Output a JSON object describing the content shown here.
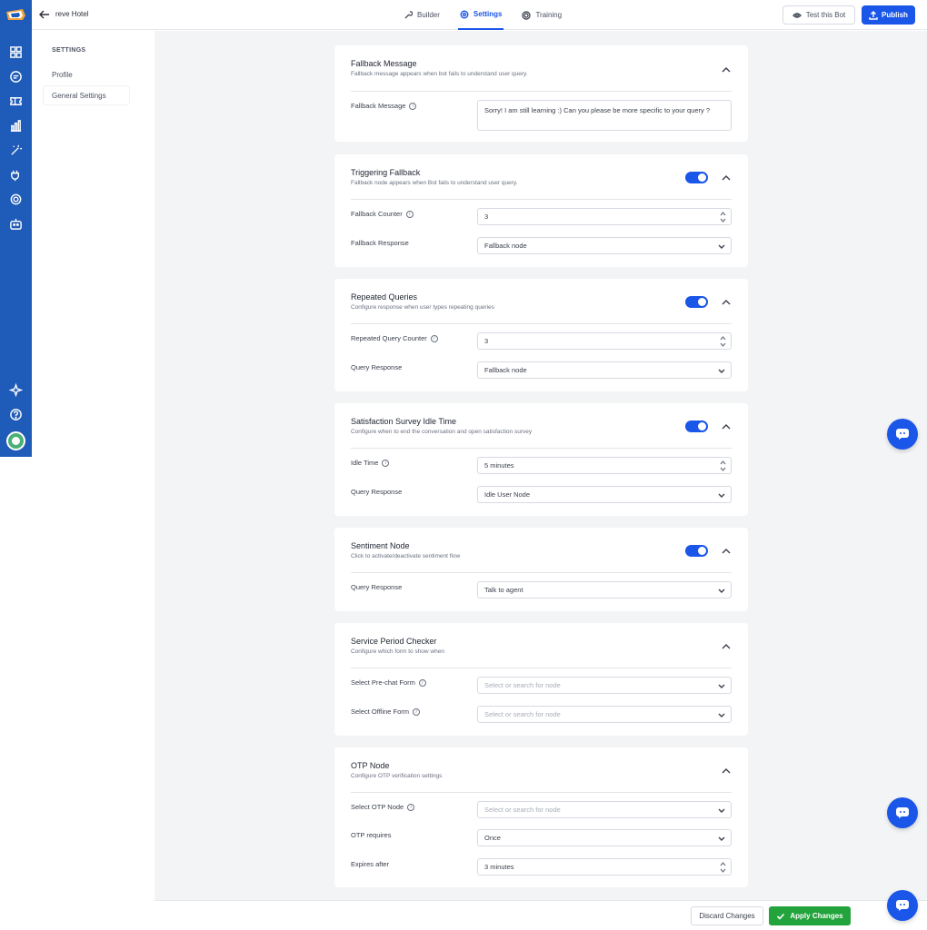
{
  "app": {
    "bot_name": "reve Hotel"
  },
  "colors": {
    "primary": "#1a56e8",
    "rail": "#1f5bb8",
    "apply": "#22a33c"
  },
  "rail": {
    "icons": [
      "logo-icon",
      "dashboard-icon",
      "chat-icon",
      "ticket-icon",
      "analytics-icon",
      "magic-wand-icon",
      "plug-icon",
      "settings-icon",
      "bot-icon",
      "sparkle-icon",
      "help-icon",
      "avatar"
    ]
  },
  "header": {
    "tabs": [
      {
        "label": "Builder",
        "icon": "wrench-icon"
      },
      {
        "label": "Settings",
        "icon": "gear-icon",
        "active": true
      },
      {
        "label": "Training",
        "icon": "target-icon"
      }
    ],
    "test_label": "Test this Bot",
    "publish_label": "Publish"
  },
  "sidebar": {
    "heading": "SETTINGS",
    "items": [
      {
        "label": "Profile"
      },
      {
        "label": "General Settings",
        "active": true
      }
    ]
  },
  "sections": {
    "fallback_message": {
      "title": "Fallback Message",
      "subtitle": "Fallback message appears when bot fails to understand user query.",
      "label": "Fallback Message",
      "value": "Sorry! I am still learning :) Can you please be more specific to your query ?"
    },
    "triggering_fallback": {
      "title": "Triggering Fallback",
      "subtitle": "Fallback node appears when Bot fails to understand user query.",
      "enabled": true,
      "counter_label": "Fallback Counter",
      "counter_value": "3",
      "response_label": "Fallback Response",
      "response_value": "Fallback node"
    },
    "repeated_queries": {
      "title": "Repeated Queries",
      "subtitle": "Configure response when user types repeating queries",
      "enabled": true,
      "counter_label": "Repeated Query Counter",
      "counter_value": "3",
      "response_label": "Query Response",
      "response_value": "Fallback node"
    },
    "survey_idle": {
      "title": "Satisfaction Survey Idle Time",
      "subtitle": "Configure when to end the conversation and open satisfaction survey",
      "enabled": true,
      "idle_label": "Idle Time",
      "idle_value": "5 minutes",
      "response_label": "Query Response",
      "response_value": "Idle User Node"
    },
    "sentiment": {
      "title": "Sentiment Node",
      "subtitle": "Click to activate/deactivate sentiment flow",
      "enabled": true,
      "response_label": "Query Response",
      "response_value": "Talk to agent"
    },
    "service_period": {
      "title": "Service Period Checker",
      "subtitle": "Configure which form to show when",
      "prechat_label": "Select Pre-chat Form",
      "prechat_placeholder": "Select or search for node",
      "offline_label": "Select Offline Form",
      "offline_placeholder": "Select or search for node"
    },
    "otp": {
      "title": "OTP Node",
      "subtitle": "Configure OTP verification settings",
      "node_label": "Select OTP Node",
      "node_placeholder": "Select or search for node",
      "requires_label": "OTP requires",
      "requires_value": "Once",
      "expires_label": "Expires after",
      "expires_value": "3 minutes"
    }
  },
  "footer": {
    "discard_label": "Discard Changes",
    "apply_label": "Apply Changes"
  }
}
